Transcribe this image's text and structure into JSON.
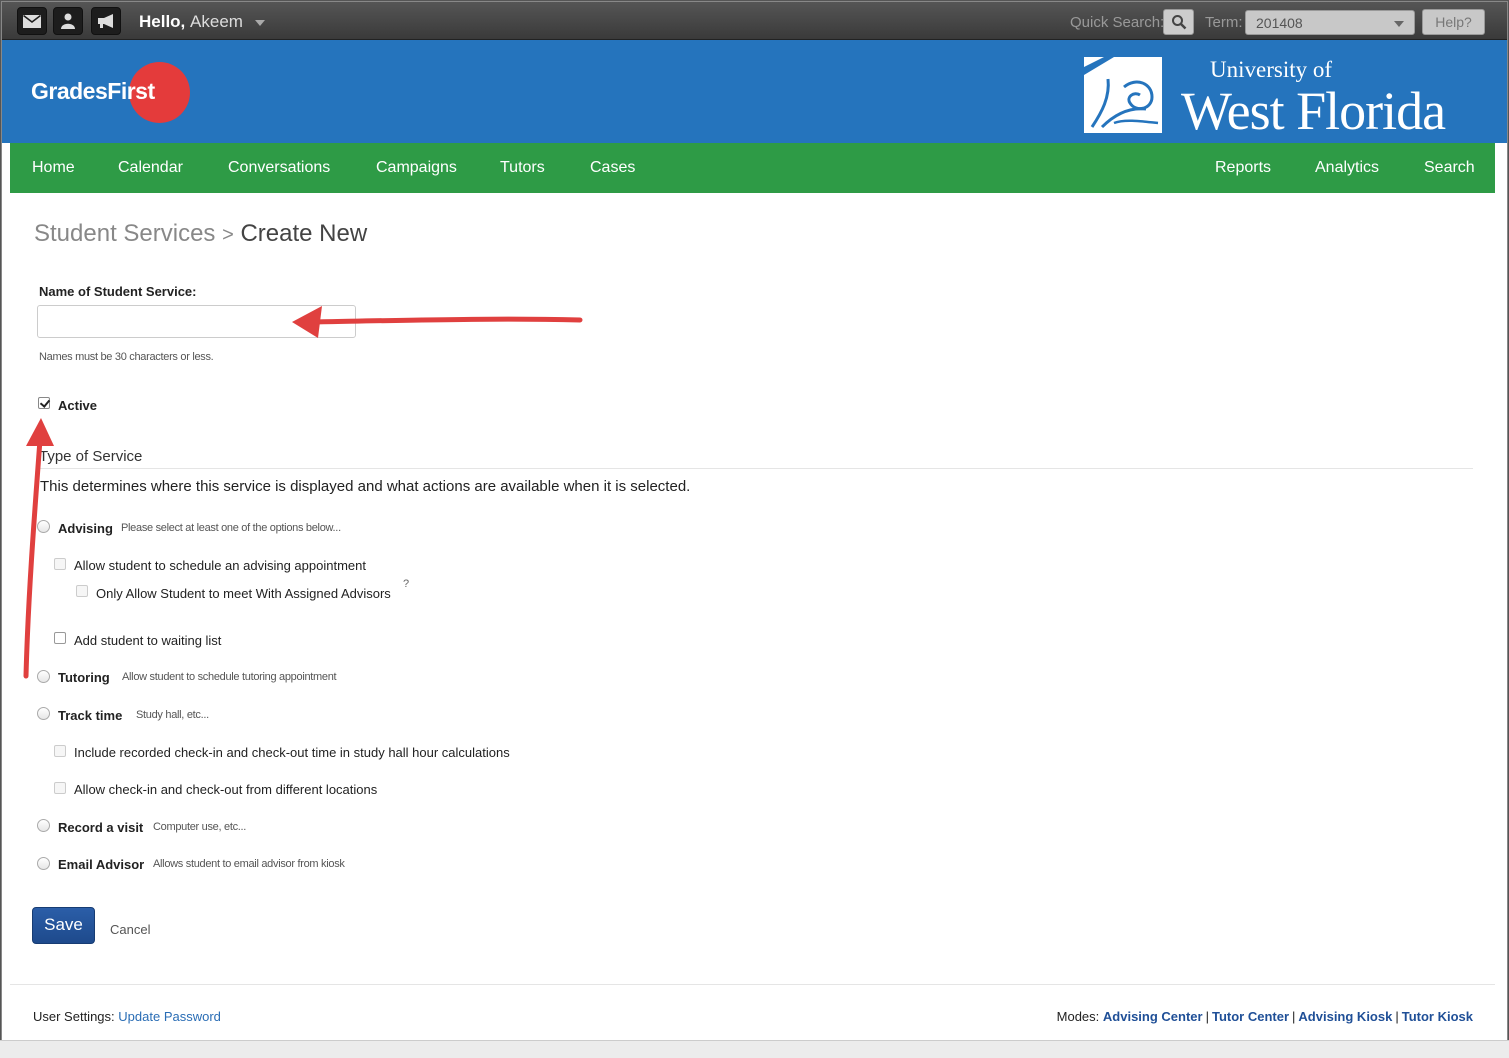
{
  "topbar": {
    "icons": [
      "mail-icon",
      "people-icon",
      "megaphone-icon"
    ],
    "hello": "Hello,",
    "user_name": "Akeem",
    "quick_search_label": "Quick Search:",
    "term_label": "Term:",
    "term_value": "201408",
    "help_label": "Help?"
  },
  "header": {
    "logo_text_grades": "Grades",
    "logo_text_first": "First",
    "university_line1": "University of",
    "university_line2": "West Florida"
  },
  "nav": {
    "left": [
      "Home",
      "Calendar",
      "Conversations",
      "Campaigns",
      "Tutors",
      "Cases"
    ],
    "right": [
      "Reports",
      "Analytics",
      "Search"
    ]
  },
  "page": {
    "breadcrumb_parent": "Student Services",
    "breadcrumb_sep": ">",
    "breadcrumb_current": "Create New",
    "name_label": "Name of Student Service:",
    "name_value": "",
    "name_hint": "Names must be 30 characters or less.",
    "active_label": "Active",
    "active_checked": true,
    "section_title": "Type of Service",
    "section_desc": "This determines where this service is displayed and what actions are available when it is selected.",
    "advising_label": "Advising",
    "advising_hint": "Please select at least one of the options below...",
    "advising_opt1": "Allow student to schedule an advising appointment",
    "advising_opt1_sub": "Only Allow Student to meet With Assigned Advisors",
    "advising_opt1_sub_help": "?",
    "advising_opt2": "Add student to waiting list",
    "tutoring_label": "Tutoring",
    "tutoring_hint": "Allow student to schedule tutoring appointment",
    "track_label": "Track time",
    "track_hint": "Study hall, etc...",
    "track_opt1": "Include recorded check-in and check-out time in study hall hour calculations",
    "track_opt2": "Allow check-in and check-out from different locations",
    "visit_label": "Record a visit",
    "visit_hint": "Computer use, etc...",
    "email_label": "Email Advisor",
    "email_hint": "Allows student to email advisor from kiosk",
    "save_label": "Save",
    "cancel_label": "Cancel"
  },
  "footer": {
    "settings_label": "User Settings:",
    "update_password": "Update Password",
    "modes_label": "Modes:",
    "modes": [
      "Advising Center",
      "Tutor Center",
      "Advising Kiosk",
      "Tutor Kiosk"
    ],
    "pipe": "|"
  },
  "colors": {
    "header_blue": "#2574bd",
    "nav_green": "#2e9b46",
    "logo_red": "#e43b3b",
    "save_blue": "#1e4a8c",
    "annotation_arrow": "#e0403f"
  }
}
